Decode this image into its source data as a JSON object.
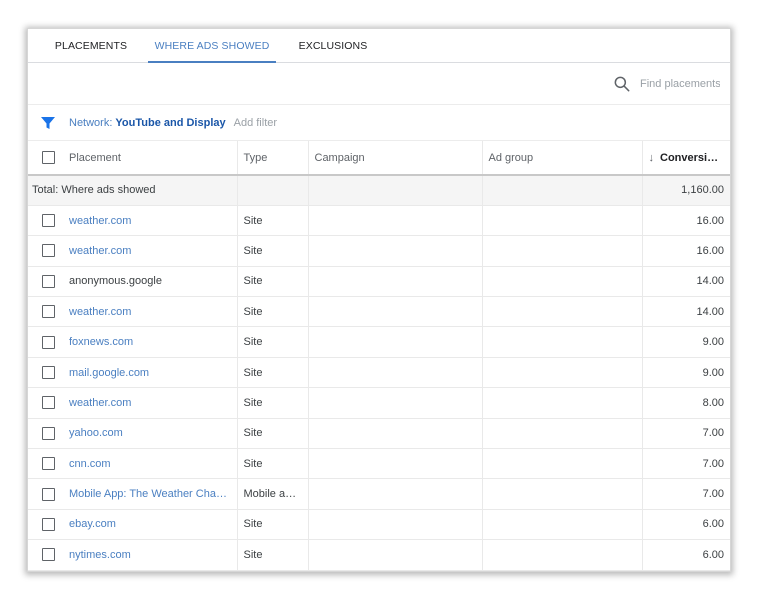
{
  "tabs": [
    {
      "label": "PLACEMENTS"
    },
    {
      "label": "WHERE ADS SHOWED"
    },
    {
      "label": "EXCLUSIONS"
    }
  ],
  "search": {
    "placeholder": "Find placements"
  },
  "filter": {
    "label": "Network:",
    "value": "YouTube and Display",
    "add_label": "Add filter"
  },
  "table": {
    "headers": {
      "placement": "Placement",
      "type": "Type",
      "campaign": "Campaign",
      "ad_group": "Ad group",
      "conversions": "Conversions"
    },
    "sort_icon": "↓",
    "total": {
      "label": "Total: Where ads showed",
      "conversions": "1,160.00"
    },
    "rows": [
      {
        "placement": "weather.com",
        "link": true,
        "type": "Site",
        "campaign": "",
        "ad_group": "",
        "conversions": "16.00"
      },
      {
        "placement": "weather.com",
        "link": true,
        "type": "Site",
        "campaign": "",
        "ad_group": "",
        "conversions": "16.00"
      },
      {
        "placement": "anonymous.google",
        "link": false,
        "type": "Site",
        "campaign": "",
        "ad_group": "",
        "conversions": "14.00"
      },
      {
        "placement": "weather.com",
        "link": true,
        "type": "Site",
        "campaign": "",
        "ad_group": "",
        "conversions": "14.00"
      },
      {
        "placement": "foxnews.com",
        "link": true,
        "type": "Site",
        "campaign": "",
        "ad_group": "",
        "conversions": "9.00"
      },
      {
        "placement": "mail.google.com",
        "link": true,
        "type": "Site",
        "campaign": "",
        "ad_group": "",
        "conversions": "9.00"
      },
      {
        "placement": "weather.com",
        "link": true,
        "type": "Site",
        "campaign": "",
        "ad_group": "",
        "conversions": "8.00"
      },
      {
        "placement": "yahoo.com",
        "link": true,
        "type": "Site",
        "campaign": "",
        "ad_group": "",
        "conversions": "7.00"
      },
      {
        "placement": "cnn.com",
        "link": true,
        "type": "Site",
        "campaign": "",
        "ad_group": "",
        "conversions": "7.00"
      },
      {
        "placement": "Mobile App: The Weather Channel App ...",
        "link": true,
        "type": "Mobile appli...",
        "campaign": "",
        "ad_group": "",
        "conversions": "7.00"
      },
      {
        "placement": "ebay.com",
        "link": true,
        "type": "Site",
        "campaign": "",
        "ad_group": "",
        "conversions": "6.00"
      },
      {
        "placement": "nytimes.com",
        "link": true,
        "type": "Site",
        "campaign": "",
        "ad_group": "",
        "conversions": "6.00"
      }
    ]
  },
  "colors": {
    "accent": "#4a7fc1",
    "link": "#4a7fc1",
    "filter_icon": "#1a73e8"
  }
}
